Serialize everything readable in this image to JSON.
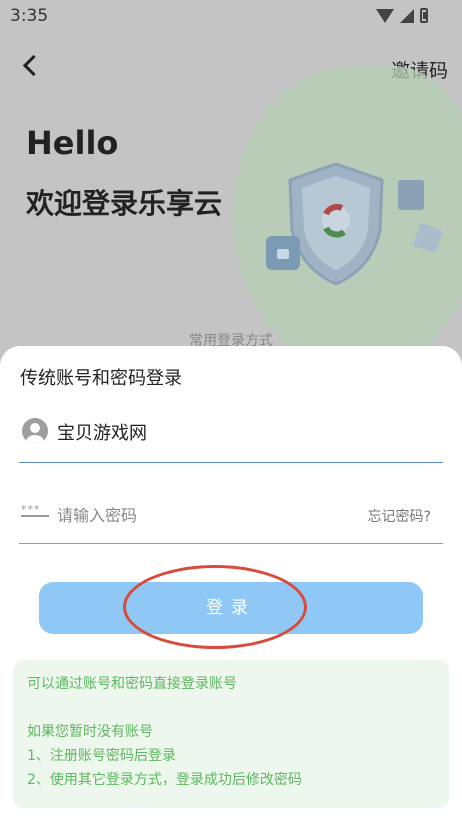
{
  "status_bar": {
    "time": "3:35"
  },
  "header": {
    "invite_label": "邀请码"
  },
  "hero": {
    "greeting": "Hello",
    "welcome": "欢迎登录乐享云",
    "faded_label": "常用登录方式"
  },
  "sheet": {
    "title": "传统账号和密码登录",
    "account_value": "宝贝游戏网",
    "password_placeholder": "请输入密码",
    "forgot_label": "忘记密码?",
    "login_label": "登录",
    "info_lines": [
      "可以通过账号和密码直接登录账号",
      "",
      "如果您暂时没有账号",
      "1、注册账号密码后登录",
      "2、使用其它登录方式，登录成功后修改密码"
    ]
  },
  "colors": {
    "accent": "#8fc8f4",
    "info_text": "#5db85f",
    "info_bg": "#eef7ee",
    "annotation": "#d84a3a"
  }
}
